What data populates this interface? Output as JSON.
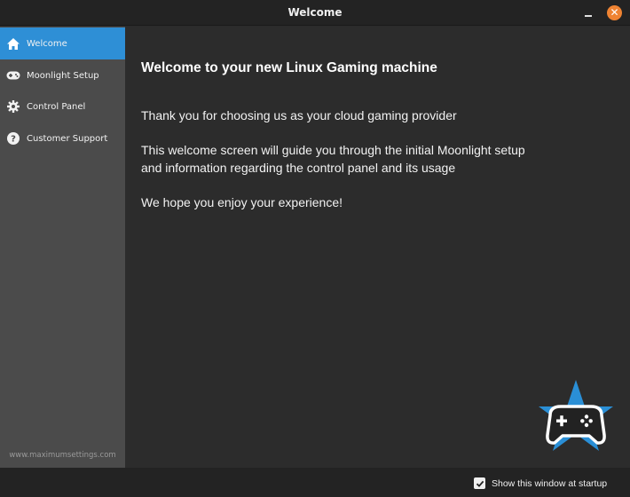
{
  "window": {
    "title": "Welcome",
    "minimize_icon": "minimize-icon",
    "close_icon": "close-icon",
    "close_glyph": "✕"
  },
  "sidebar": {
    "items": [
      {
        "label": "Welcome",
        "icon": "home-icon",
        "active": true
      },
      {
        "label": "Moonlight Setup",
        "icon": "gamepad-icon",
        "active": false
      },
      {
        "label": "Control Panel",
        "icon": "gear-icon",
        "active": false
      },
      {
        "label": "Customer Support",
        "icon": "help-icon",
        "active": false
      }
    ],
    "footer": "www.maximumsettings.com"
  },
  "main": {
    "heading": "Welcome to your new Linux Gaming machine",
    "paragraph1": "Thank you for choosing us as your cloud gaming provider",
    "paragraph2_line1": "This welcome screen will guide you through the initial Moonlight setup",
    "paragraph2_line2": "and information regarding the control panel and its usage",
    "paragraph3": "We hope you enjoy your experience!",
    "logo_icon": "star-gamepad-logo-icon"
  },
  "footer_bar": {
    "show_at_startup_label": "Show this window at startup",
    "show_at_startup_checked": true
  },
  "colors": {
    "accent": "#2e8fd6",
    "close": "#ef8332",
    "sidebar": "#4b4b4b",
    "background": "#2c2c2c",
    "logo_star": "#2a8fd6"
  }
}
